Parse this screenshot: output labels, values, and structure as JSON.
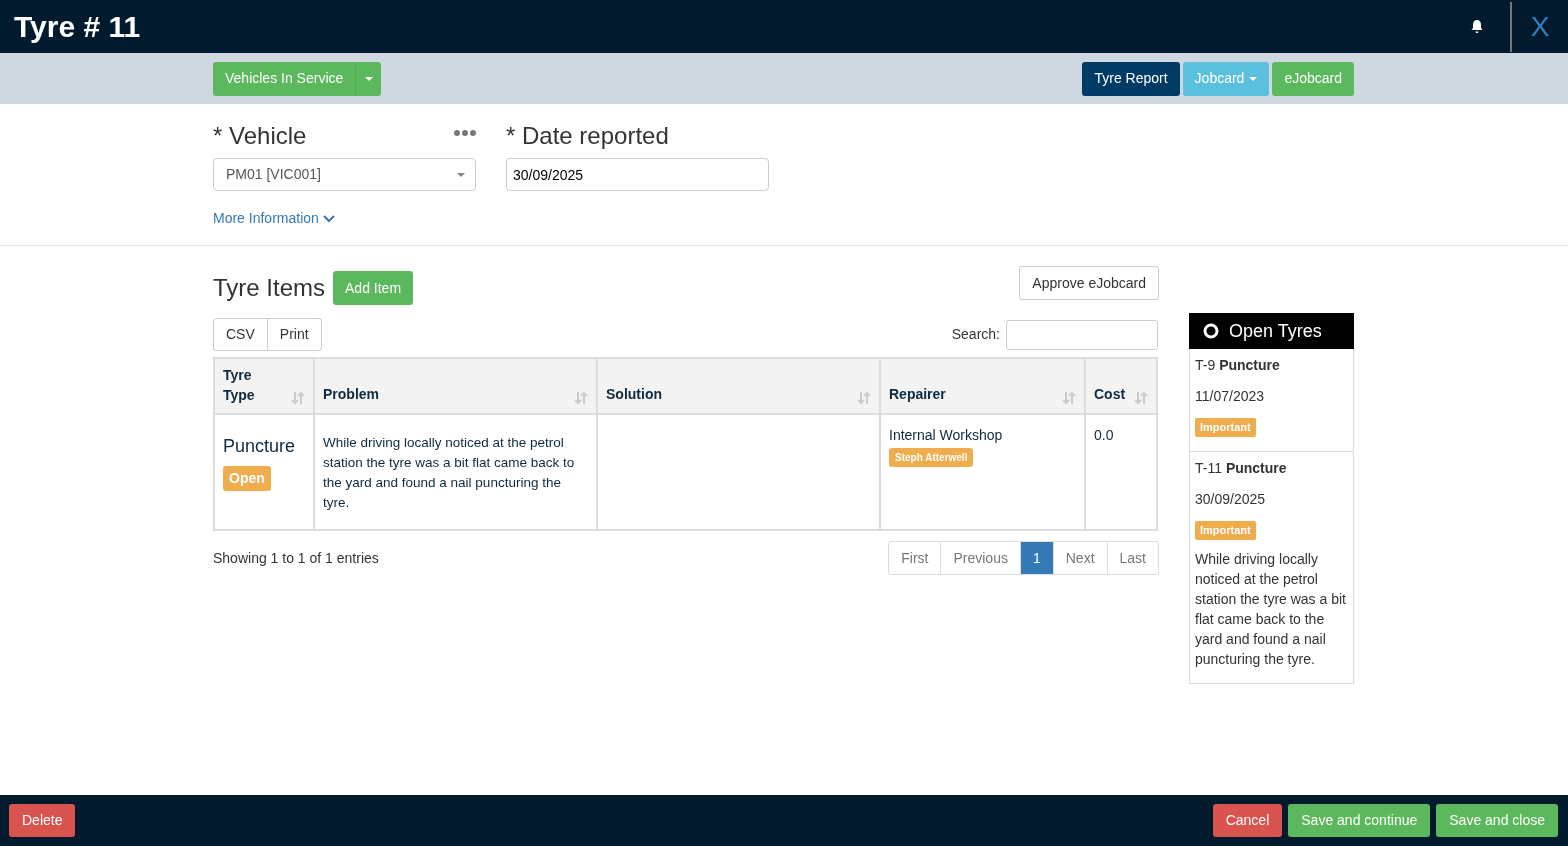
{
  "header": {
    "title": "Tyre # 11",
    "close": "X"
  },
  "toolbar": {
    "left_button": "Vehicles In Service",
    "right_buttons": [
      {
        "label": "Tyre Report",
        "kind": "dark"
      },
      {
        "label": "Jobcard",
        "kind": "dropdown"
      },
      {
        "label": "eJobcard",
        "kind": "green"
      }
    ]
  },
  "form": {
    "fields": [
      {
        "label": "* Vehicle",
        "kind": "select",
        "value": "PM01 [VIC001]"
      },
      {
        "label": "* Date reported",
        "kind": "text",
        "value": "30/09/2025"
      }
    ],
    "more_link": "More Information"
  },
  "items": {
    "title": "Tyre Items",
    "add_button": "Add Item",
    "approve_button": "Approve eJobcard",
    "export_buttons": [
      "CSV",
      "Print"
    ],
    "search_label": "Search:",
    "columns": [
      "Tyre Type",
      "Problem",
      "Solution",
      "Repairer",
      "Cost"
    ],
    "rows": [
      {
        "tyre_type": "Puncture",
        "status": "Open",
        "problem": "While driving locally noticed at the petrol station the tyre was a bit flat came back to the yard and found a nail puncturing the tyre.",
        "solution": "",
        "repairer": "Internal Workshop",
        "assignee": "Steph Atterwell",
        "cost": "0.0"
      }
    ],
    "info": "Showing 1 to 1 of 1 entries",
    "pages": [
      {
        "label": "First",
        "selected": false
      },
      {
        "label": "Previous",
        "selected": false
      },
      {
        "label": "1",
        "selected": true
      },
      {
        "label": "Next",
        "selected": false
      },
      {
        "label": "Last",
        "selected": false
      }
    ]
  },
  "open_tyres": {
    "title": "Open Tyres",
    "items": [
      {
        "heading": "T-9 **Puncture**",
        "date": "11/07/2023",
        "tag": "Important"
      },
      {
        "heading": "T-11 **Puncture**",
        "date": "30/09/2025",
        "tag": "Important",
        "description": "While driving locally noticed at the petrol station the tyre was a bit flat came back to the yard and found a nail puncturing the tyre."
      }
    ]
  },
  "footer": {
    "delete": "Delete",
    "buttons": [
      {
        "label": "Cancel",
        "kind": "danger"
      },
      {
        "label": "Save and continue",
        "kind": "success"
      },
      {
        "label": "Save and close",
        "kind": "success"
      }
    ]
  }
}
